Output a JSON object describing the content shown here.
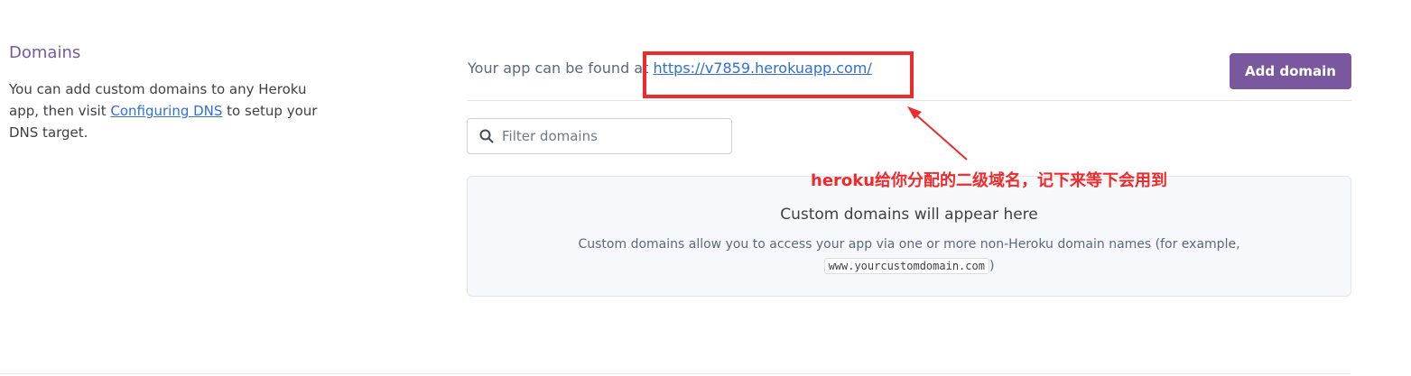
{
  "domains": {
    "title": "Domains",
    "desc_before_link": "You can add custom domains to any Heroku app, then visit ",
    "desc_link": "Configuring DNS",
    "desc_after_link": " to setup your DNS target.",
    "found_prefix": "Your app can be found at ",
    "app_url": "https://v7859.herokuapp.com/",
    "add_button": "Add domain",
    "filter_placeholder": "Filter domains",
    "empty_title": "Custom domains will appear here",
    "empty_desc_before": "Custom domains allow you to access your app via one or more non-Heroku domain names (for example, ",
    "empty_example": "www.yourcustomdomain.com",
    "empty_desc_after": ")"
  },
  "annotation": {
    "text": "heroku给你分配的二级域名，记下来等下会用到",
    "color": "#ee2a2a"
  },
  "colors": {
    "brand_purple": "#79589f",
    "link_blue": "#2e6fd8"
  },
  "icons": {
    "search": "search-icon"
  }
}
